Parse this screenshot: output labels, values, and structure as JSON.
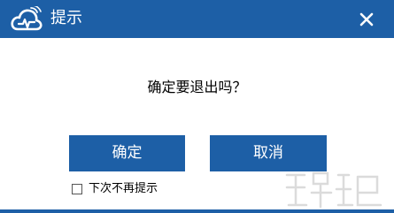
{
  "window": {
    "title": "提示",
    "logo_icon": "cloud-logo-icon",
    "close_icon": "close-icon",
    "accent_color": "#1d5fa6"
  },
  "dialog": {
    "message": "确定要退出吗？",
    "ok_label": "确定",
    "cancel_label": "取消",
    "dont_show_label": "下次不再提示",
    "dont_show_checked": false
  }
}
